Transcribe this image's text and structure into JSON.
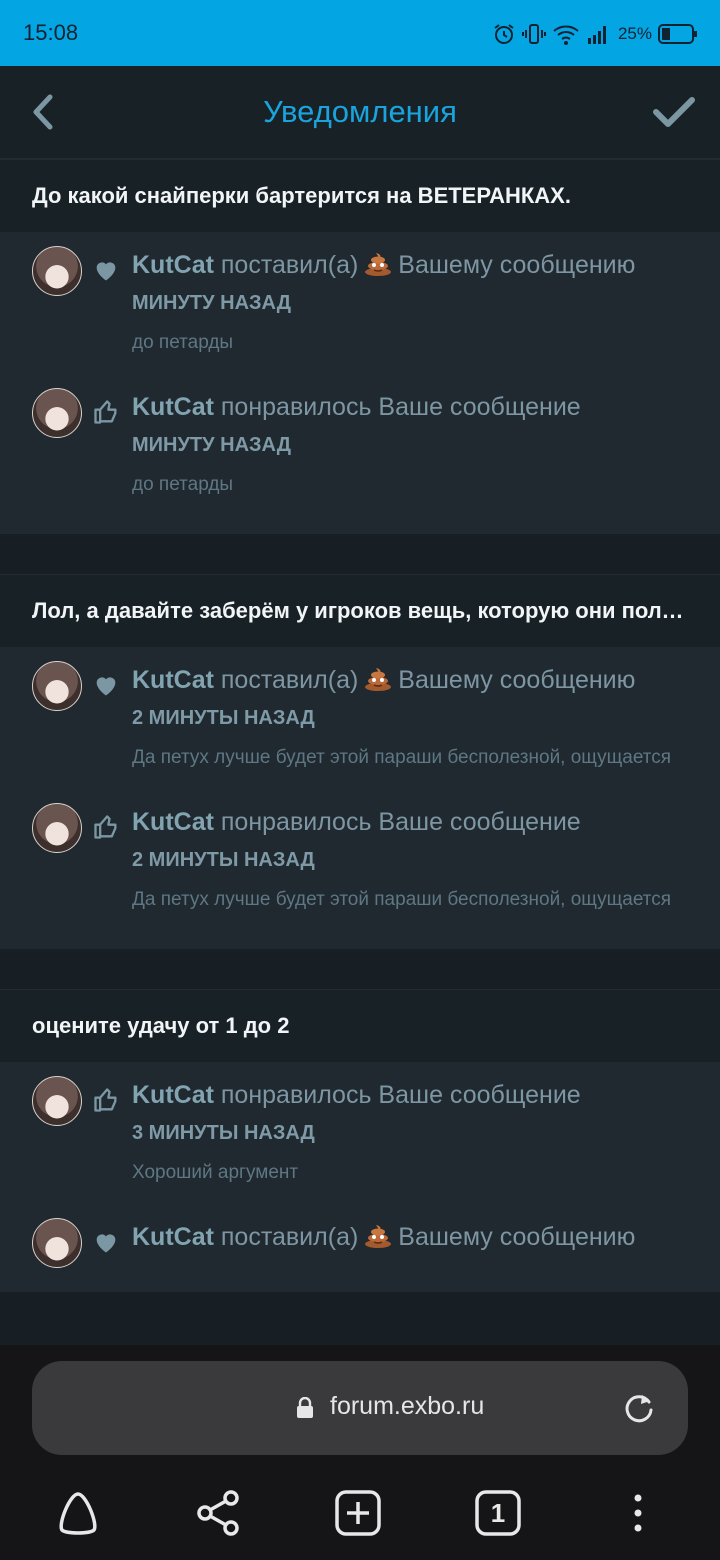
{
  "status_bar": {
    "time": "15:08",
    "battery": "25%"
  },
  "header": {
    "title": "Уведомления"
  },
  "groups": [
    {
      "title": "До какой снайперки бартерится на ВЕТЕРАНКАХ.",
      "items": [
        {
          "icon": "heart-icon",
          "author": "KutCat",
          "action": "поставил(а)",
          "emoji": "poop-emoji",
          "action2": "Вашему сообщению",
          "time": "минуту назад",
          "excerpt": "до петарды"
        },
        {
          "icon": "thumbs-up-icon",
          "author": "KutCat",
          "action": "понравилось Ваше сообщение",
          "time": "минуту назад",
          "excerpt": "до петарды"
        }
      ]
    },
    {
      "title": "Лол, а давайте заберём у игроков вещь, которую они получили в награду",
      "items": [
        {
          "icon": "heart-icon",
          "author": "KutCat",
          "action": "поставил(а)",
          "emoji": "poop-emoji",
          "action2": "Вашему сообщению",
          "time": "2 минуты назад",
          "excerpt": "Да петух лучше будет этой параши бесполезной, ощущается"
        },
        {
          "icon": "thumbs-up-icon",
          "author": "KutCat",
          "action": "понравилось Ваше сообщение",
          "time": "2 минуты назад",
          "excerpt": "Да петух лучше будет этой параши бесполезной, ощущается"
        }
      ]
    },
    {
      "title": "оцените удачу от 1 до 2",
      "items": [
        {
          "icon": "thumbs-up-icon",
          "author": "KutCat",
          "action": "понравилось Ваше сообщение",
          "time": "3 минуты назад",
          "excerpt": "Хороший аргумент"
        },
        {
          "icon": "heart-icon",
          "author": "KutCat",
          "action": "поставил(а)",
          "emoji": "poop-emoji",
          "action2": "Вашему сообщению",
          "time": "",
          "excerpt": ""
        }
      ]
    }
  ],
  "browser": {
    "url": "forum.exbo.ru",
    "tab_count": "1"
  },
  "colors": {
    "accent": "#1aa3dc",
    "status_bar": "#03a6e2",
    "background": "#171f24"
  }
}
